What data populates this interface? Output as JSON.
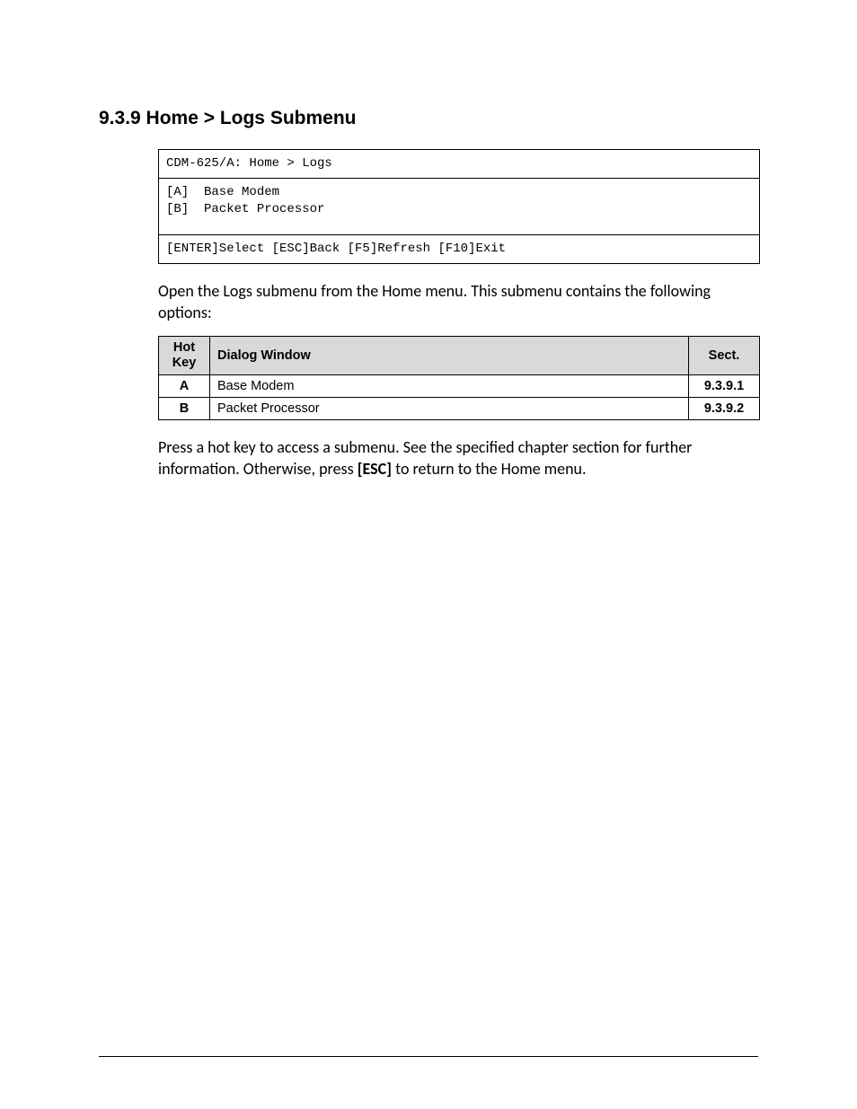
{
  "heading": "9.3.9  Home > Logs Submenu",
  "terminal": {
    "title": "CDM-625/A: Home > Logs",
    "options": [
      "[A]  Base Modem",
      "[B]  Packet Processor"
    ],
    "footer": "[ENTER]Select [ESC]Back [F5]Refresh [F10]Exit"
  },
  "para1": "Open the Logs submenu from the Home menu. This submenu contains the following options:",
  "table": {
    "headers": {
      "hotkey": "Hot Key",
      "dialog": "Dialog Window",
      "sect": "Sect."
    },
    "rows": [
      {
        "hotkey": "A",
        "dialog": "Base Modem",
        "sect": "9.3.9.1"
      },
      {
        "hotkey": "B",
        "dialog": "Packet Processor",
        "sect": "9.3.9.2"
      }
    ]
  },
  "para2_pre": "Press a hot key to access a submenu. See the specified chapter section for further information. Otherwise, press ",
  "para2_bold": "[ESC]",
  "para2_post": " to return to the Home menu."
}
